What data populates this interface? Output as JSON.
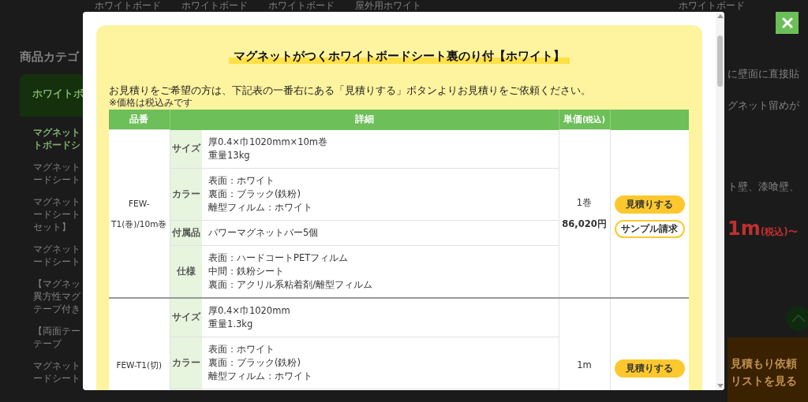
{
  "background": {
    "nav_items": [
      "ホワイトボード",
      "ホワイトボード",
      "ホワイトボード",
      "屋外用ホワイト",
      "ホワイトボード"
    ],
    "sidebar": {
      "heading": "商品カテゴ",
      "active_tab": "ホワイトボ",
      "items": [
        [
          "マグネット",
          "トボードシ"
        ],
        [
          "マグネット",
          "ードシート"
        ],
        [
          "マグネット",
          "ードシート",
          "セット】"
        ],
        [
          "マグネット",
          "ードシート"
        ],
        [
          "【マグネッ",
          "異方性マグ",
          "テープ付き"
        ],
        [
          "【両面テー",
          "テープ"
        ],
        [
          "マグネット",
          "ードシート"
        ]
      ]
    },
    "right_texts": [
      "に壁面に直接貼",
      "グネット留めが",
      "ト壁、漆喰壁、"
    ],
    "price": {
      "value": "1m",
      "note": "(税込)〜"
    },
    "quote_list_button": [
      "見積もり依頼",
      "リストを見る"
    ]
  },
  "modal": {
    "title": "マグネットがつくホワイトボードシート裏のり付【ホワイト】",
    "intro": "お見積りをご希望の方は、下記表の一番右にある「見積りする」ボタンよりお見積りをご依頼ください。",
    "note": "※価格は税込みです",
    "table": {
      "columns": [
        {
          "label": "品番"
        },
        {
          "label": "詳細"
        },
        {
          "label": "単価",
          "note": "(税込)"
        },
        {}
      ],
      "rows": [
        {
          "part_no": "FEW-T1(巻)/10m巻",
          "specs": [
            {
              "label": "サイズ",
              "lines": [
                "厚0.4×巾1020mm×10m巻",
                "重量13kg"
              ]
            },
            {
              "label": "カラー",
              "lines": [
                "表面：ホワイト",
                "裏面：ブラック(鉄粉)",
                "離型フィルム：ホワイト"
              ]
            },
            {
              "label": "付属品",
              "lines": [
                "パワーマグネットバー5個"
              ]
            },
            {
              "label": "仕様",
              "lines": [
                "表面：ハードコートPETフィルム",
                "中間：鉄粉シート",
                "裏面：アクリル系粘着剤/離型フィルム"
              ]
            }
          ],
          "price_lines": [
            "1巻",
            "86,020円"
          ],
          "buttons": [
            {
              "label": "見積りする",
              "kind": "quote"
            },
            {
              "label": "サンプル請求",
              "kind": "sample"
            }
          ]
        },
        {
          "part_no": "FEW-T1(切)",
          "specs": [
            {
              "label": "サイズ",
              "lines": [
                "厚0.4×巾1020mm",
                "重量1.3kg"
              ]
            },
            {
              "label": "カラー",
              "lines": [
                "表面：ホワイト",
                "裏面：ブラック(鉄粉)",
                "離型フィルム：ホワイト"
              ]
            }
          ],
          "price_lines": [
            "1m"
          ],
          "buttons": [
            {
              "label": "見積りする",
              "kind": "quote"
            }
          ]
        }
      ]
    }
  }
}
